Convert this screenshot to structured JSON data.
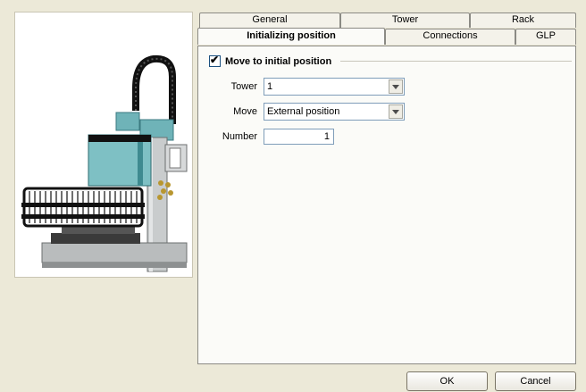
{
  "tabs_row1": [
    "General",
    "Tower",
    "Rack"
  ],
  "tabs_row2": [
    "Initializing position",
    "Connections",
    "GLP"
  ],
  "active_tab": "Initializing position",
  "group": {
    "checkbox_label": "Move to initial position",
    "checked": true
  },
  "fields": {
    "tower_label": "Tower",
    "tower_value": "1",
    "move_label": "Move",
    "move_value": "External position",
    "number_label": "Number",
    "number_value": "1"
  },
  "buttons": {
    "ok": "OK",
    "cancel": "Cancel"
  },
  "colors": {
    "frame_teal": "#6fb3b8",
    "rack_black": "#111111",
    "base_gray": "#b9bcbd"
  }
}
